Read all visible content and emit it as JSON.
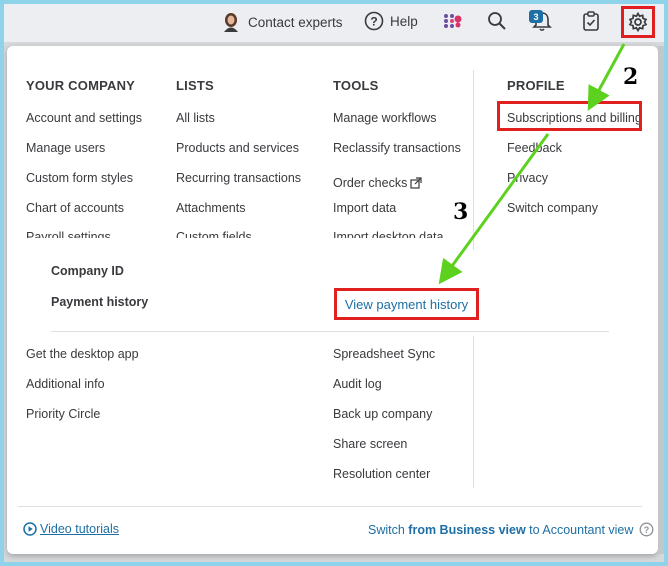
{
  "topbar": {
    "contact_label": "Contact experts",
    "help_label": "Help",
    "notification_count": "3"
  },
  "columns": {
    "your_company": {
      "heading": "YOUR COMPANY",
      "items": [
        "Account and settings",
        "Manage users",
        "Custom form styles",
        "Chart of accounts",
        "Payroll settings"
      ]
    },
    "lists": {
      "heading": "LISTS",
      "items": [
        "All lists",
        "Products and services",
        "Recurring transactions",
        "Attachments",
        "Custom fields"
      ]
    },
    "tools": {
      "heading": "TOOLS",
      "items": [
        "Manage workflows",
        "Reclassify transactions",
        "Order checks",
        "Import data",
        "Import desktop data"
      ]
    },
    "profile": {
      "heading": "PROFILE",
      "items": [
        "Subscriptions and billing",
        "Feedback",
        "Privacy",
        "Switch company"
      ]
    }
  },
  "subscription_section": {
    "company_id_label": "Company ID",
    "payment_history_label": "Payment history",
    "view_payment_history_link": "View payment history"
  },
  "bottom_left": [
    "Get the desktop app",
    "Additional info",
    "Priority Circle"
  ],
  "bottom_tools": [
    "Spreadsheet Sync",
    "Audit log",
    "Back up company",
    "Share screen",
    "Resolution center"
  ],
  "footer": {
    "video_tutorials": "Video tutorials",
    "switch_prefix": "Switch ",
    "switch_bold": "from Business view",
    "switch_suffix": " to Accountant view"
  },
  "annotations": {
    "step2": "2",
    "step3": "3"
  },
  "colors": {
    "link_blue": "#1d6fa5",
    "highlight_red": "#e0201f",
    "arrow_green": "#5cd21f",
    "frame_blue": "#8fd3ea"
  }
}
